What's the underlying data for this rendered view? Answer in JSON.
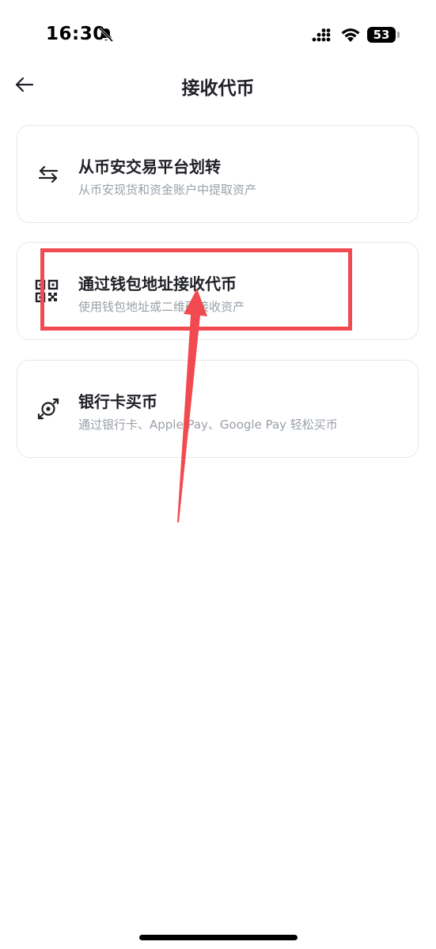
{
  "status_bar": {
    "time": "16:30",
    "battery": "53",
    "icons": [
      "bell-slash-icon",
      "signal-icon",
      "wifi-icon",
      "battery-icon"
    ]
  },
  "header": {
    "title": "接收代币",
    "back_icon": "arrow-left-icon"
  },
  "options": [
    {
      "title": "从币安交易平台划转",
      "subtitle": "从币安现货和资金账户中提取资产",
      "icon": "transfer-arrows-icon"
    },
    {
      "title": "通过钱包地址接收代币",
      "subtitle": "使用钱包地址或二维码接收资产",
      "icon": "qr-code-icon"
    },
    {
      "title": "银行卡买币",
      "subtitle": "通过银行卡、Apple Pay、Google Pay 轻松买币",
      "icon": "buy-crypto-icon"
    }
  ],
  "colors": {
    "annotation": "#f14b51",
    "card_border": "#e6e8ea",
    "text_primary": "#1e2026",
    "text_secondary": "#9aa0a8"
  }
}
